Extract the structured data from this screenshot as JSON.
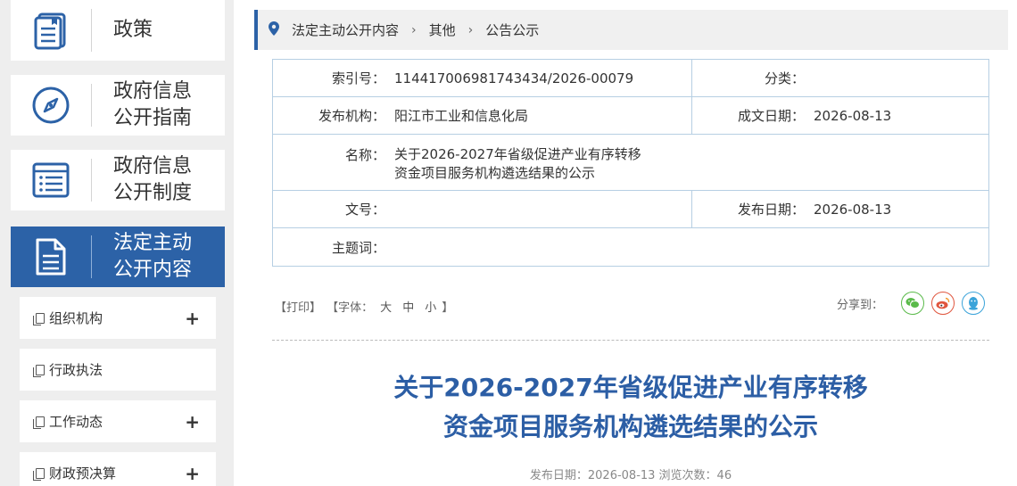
{
  "sidebar": {
    "big_items": [
      {
        "label": "政策",
        "icon": "document-icon"
      },
      {
        "label": "政府信息\n公开指南",
        "icon": "compass-icon"
      },
      {
        "label": "政府信息\n公开制度",
        "icon": "list-icon"
      },
      {
        "label": "法定主动\n公开内容",
        "icon": "file-icon",
        "active": true
      }
    ],
    "sub_items": [
      {
        "label": "组织机构",
        "expand": "+"
      },
      {
        "label": "行政执法",
        "expand": ""
      },
      {
        "label": "工作动态",
        "expand": "+"
      },
      {
        "label": "财政预决算",
        "expand": "+"
      }
    ]
  },
  "breadcrumb": {
    "items": [
      "法定主动公开内容",
      "其他",
      "公告公示"
    ],
    "separator": "›"
  },
  "info": {
    "index_label": "索引号：",
    "index_value": "114417006981743434/2026-00079",
    "category_label": "分类：",
    "category_value": "",
    "publisher_label": "发布机构：",
    "publisher_value": "阳江市工业和信息化局",
    "written_date_label": "成文日期：",
    "written_date_value": "2026-08-13",
    "name_label": "名称：",
    "name_value": "关于2026-2027年省级促进产业有序转移\n资金项目服务机构遴选结果的公示",
    "doc_no_label": "文号：",
    "doc_no_value": "",
    "publish_date_label": "发布日期：",
    "publish_date_value": "2026-08-13",
    "subject_label": "主题词：",
    "subject_value": ""
  },
  "tools": {
    "print": "【打印】",
    "font_prefix": "【字体：",
    "font_large": "大",
    "font_medium": "中",
    "font_small": "小",
    "font_suffix": "】",
    "share_label": "分享到：",
    "share_colors": {
      "wechat": "#5aba4a",
      "weibo": "#e0563e",
      "qq": "#3aa3d9"
    }
  },
  "article": {
    "title": "关于2026-2027年省级促进产业有序转移\n资金项目服务机构遴选结果的公示",
    "meta": "发布日期：2026-08-13  浏览次数：46"
  }
}
